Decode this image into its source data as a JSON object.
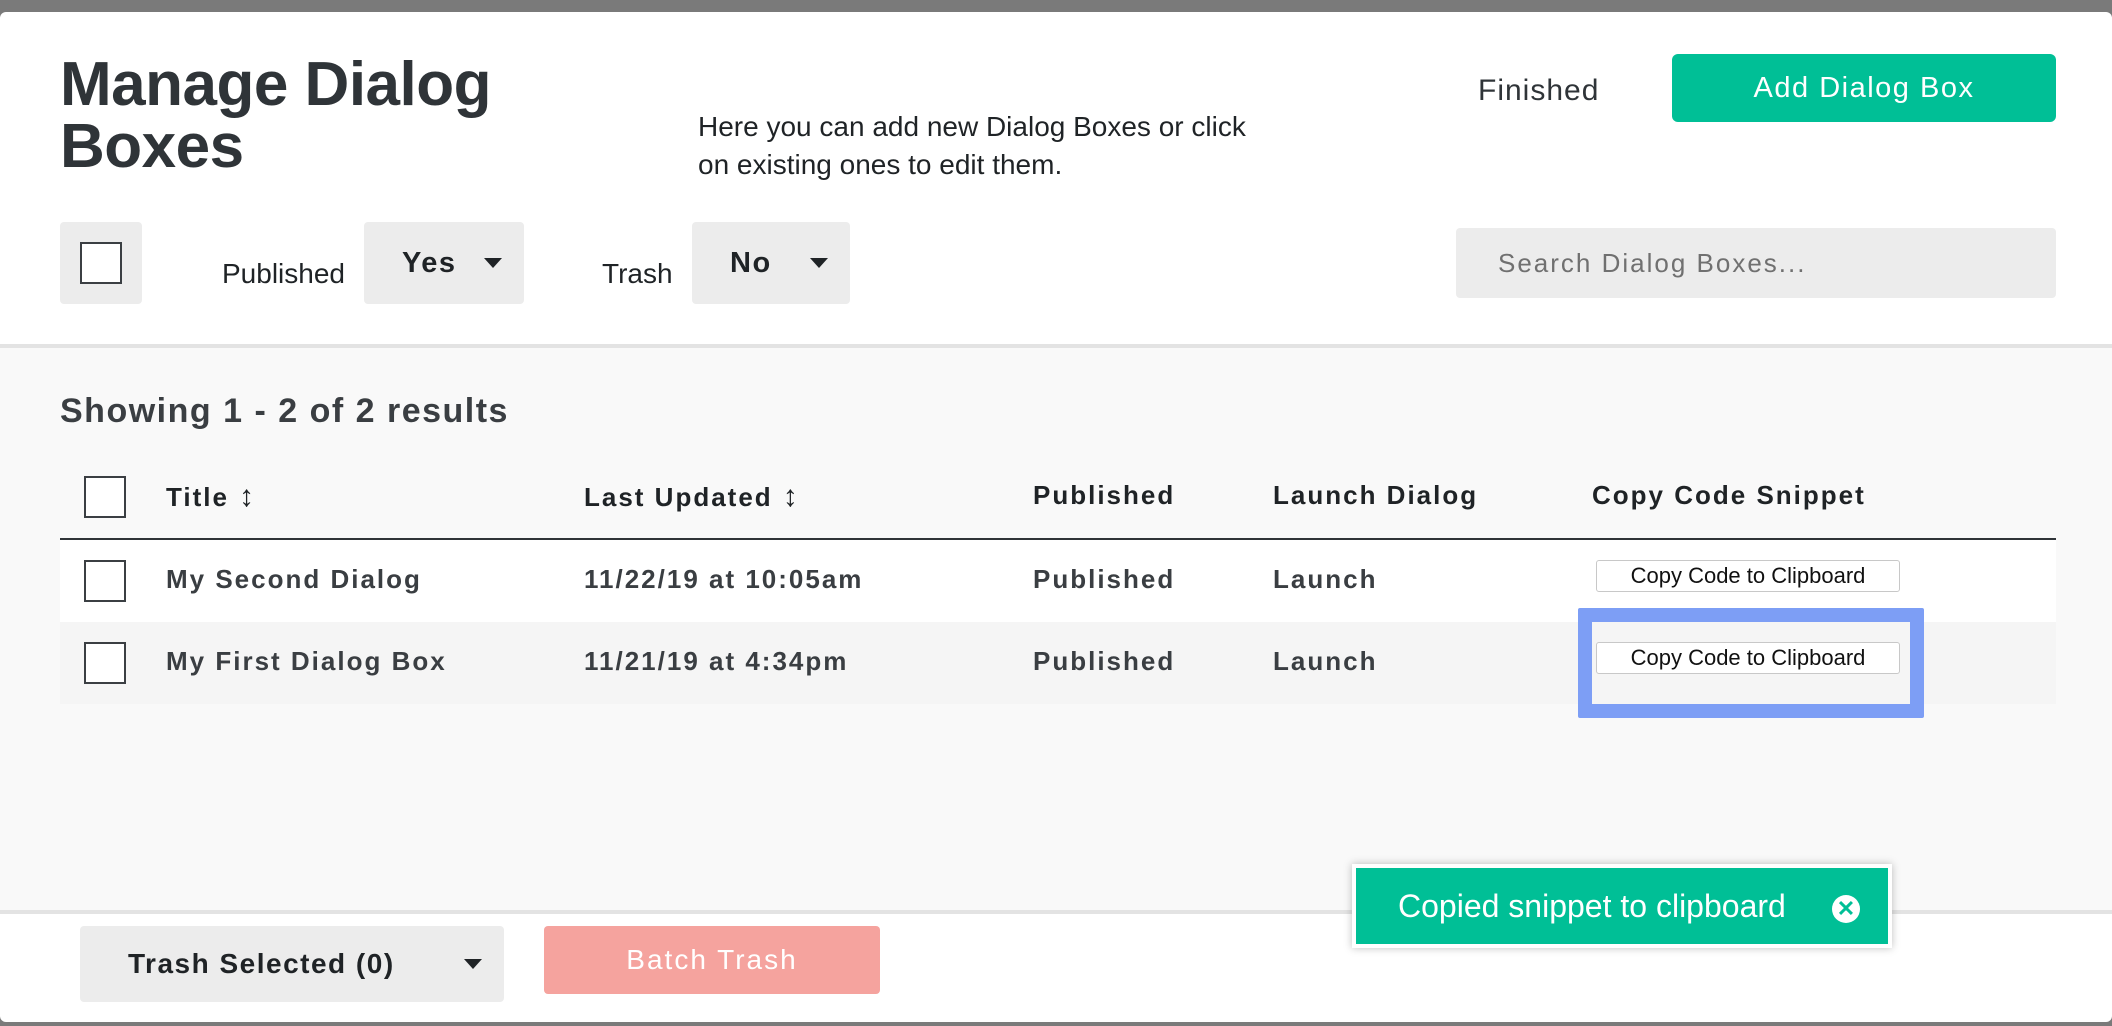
{
  "header": {
    "title": "Manage Dialog Boxes",
    "intro": "Here you can add new Dialog Boxes or click on existing ones to edit them.",
    "finished_label": "Finished",
    "add_label": "Add Dialog Box"
  },
  "filters": {
    "published_label": "Published",
    "published_value": "Yes",
    "trash_label": "Trash",
    "trash_value": "No",
    "search_placeholder": "Search Dialog Boxes..."
  },
  "results_text": "Showing 1 - 2 of 2 results",
  "table": {
    "columns": {
      "title": "Title",
      "last_updated": "Last Updated",
      "published": "Published",
      "launch": "Launch Dialog",
      "copy": "Copy Code Snippet"
    },
    "sort_glyph": "↕",
    "rows": [
      {
        "title": "My Second Dialog",
        "updated": "11/22/19 at 10:05am",
        "published": "Published",
        "launch": "Launch",
        "copy": "Copy Code to Clipboard"
      },
      {
        "title": "My First Dialog Box",
        "updated": "11/21/19 at 4:34pm",
        "published": "Published",
        "launch": "Launch",
        "copy": "Copy Code to Clipboard"
      }
    ]
  },
  "footer": {
    "trash_selected": "Trash Selected (0)",
    "batch_trash": "Batch Trash"
  },
  "toast": {
    "message": "Copied snippet to clipboard",
    "close_glyph": "✕"
  },
  "colors": {
    "accent": "#00bf96",
    "danger_disabled": "#f5a39e",
    "focus_ring": "#7d9ef5"
  },
  "icons": {
    "sort": "sort-icon",
    "caret": "caret-down-icon",
    "close": "close-icon"
  }
}
